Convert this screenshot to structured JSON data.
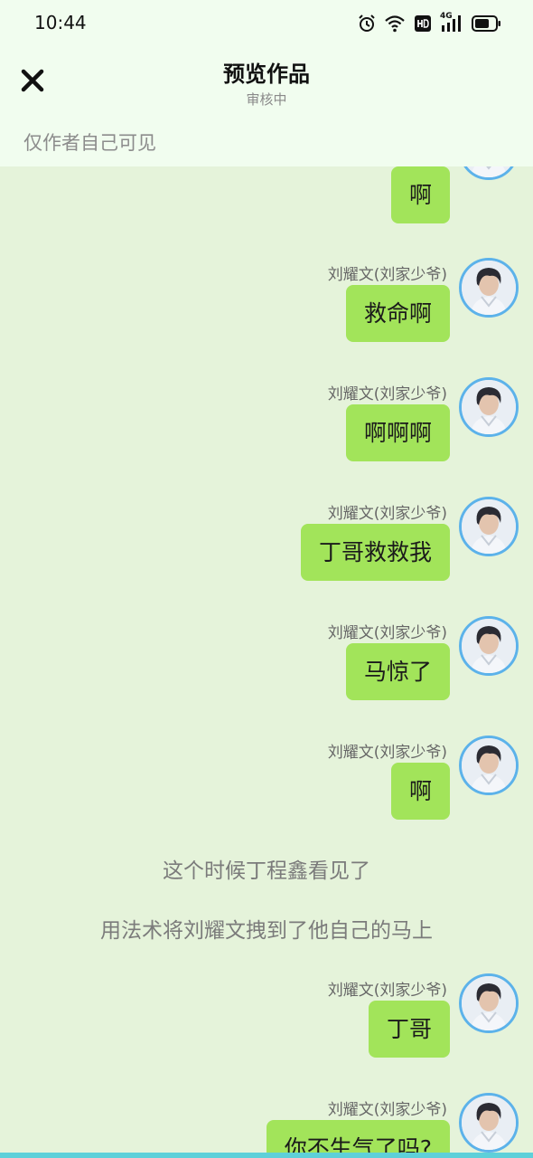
{
  "status_bar": {
    "time": "10:44",
    "network": "4G"
  },
  "header": {
    "title": "预览作品",
    "subtitle": "审核中",
    "visibility_note": "仅作者自己可见"
  },
  "messages": [
    {
      "sender": "",
      "text": "啊"
    },
    {
      "sender": "刘耀文(刘家少爷)",
      "text": "救命啊"
    },
    {
      "sender": "刘耀文(刘家少爷)",
      "text": "啊啊啊"
    },
    {
      "sender": "刘耀文(刘家少爷)",
      "text": "丁哥救救我"
    },
    {
      "sender": "刘耀文(刘家少爷)",
      "text": "马惊了"
    },
    {
      "sender": "刘耀文(刘家少爷)",
      "text": "啊"
    },
    {
      "sender": "刘耀文(刘家少爷)",
      "text": "丁哥"
    },
    {
      "sender": "刘耀文(刘家少爷)",
      "text": "你不生气了吗?"
    }
  ],
  "narrations": [
    "这个时候丁程鑫看见了",
    "用法术将刘耀文拽到了他自己的马上"
  ],
  "colors": {
    "bubble": "#a2e45a",
    "avatar_ring": "#5cb2ea",
    "background": "#e5f3da",
    "header": "#f1fdef"
  }
}
